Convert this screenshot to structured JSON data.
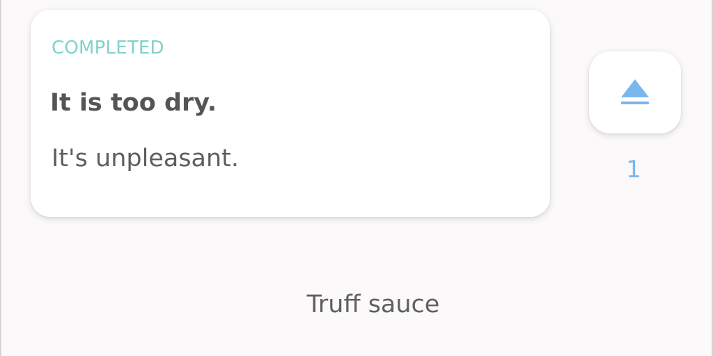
{
  "feedback_card": {
    "status": "COMPLETED",
    "title": "It is too dry.",
    "body": "It's unpleasant."
  },
  "vote": {
    "icon": "upvote-triangle-icon",
    "count": "1",
    "accent_color": "#7ab7ec"
  },
  "footer": {
    "label": "Truff sauce"
  },
  "colors": {
    "status": "#7fd3c9",
    "background": "#fbf9fa"
  }
}
